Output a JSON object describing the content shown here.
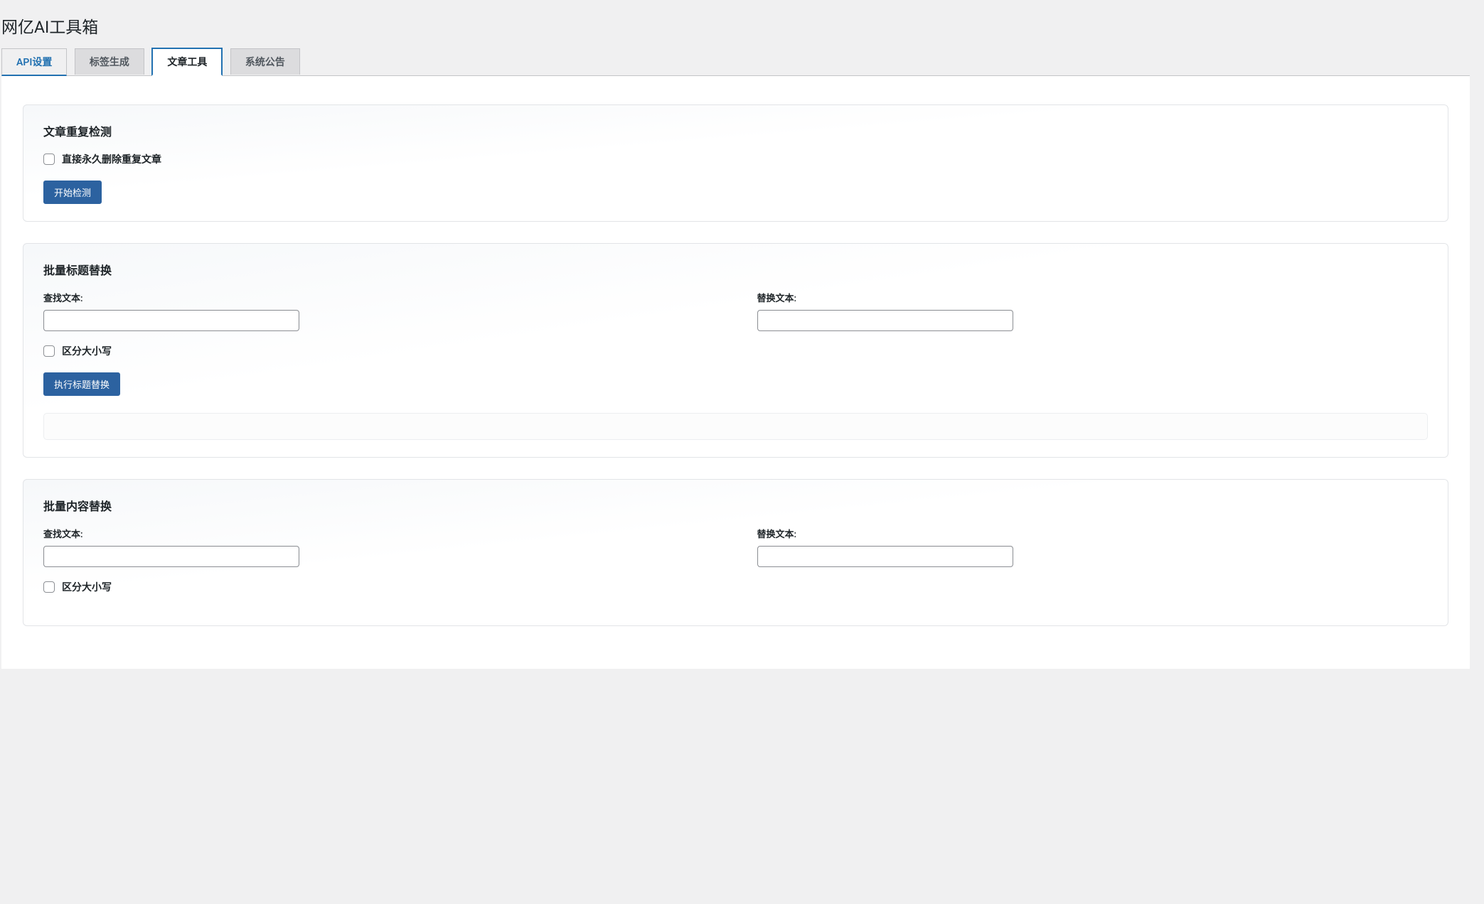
{
  "page": {
    "title": "网亿AI工具箱"
  },
  "tabs": {
    "api": "API设置",
    "tags": "标签生成",
    "article": "文章工具",
    "notice": "系统公告"
  },
  "dup": {
    "title": "文章重复检测",
    "delete_label": "直接永久删除重复文章",
    "start_btn": "开始检测"
  },
  "title_replace": {
    "title": "批量标题替换",
    "find_label": "查找文本:",
    "replace_label": "替换文本:",
    "case_label": "区分大小写",
    "exec_btn": "执行标题替换"
  },
  "content_replace": {
    "title": "批量内容替换",
    "find_label": "查找文本:",
    "replace_label": "替换文本:",
    "case_label": "区分大小写"
  }
}
